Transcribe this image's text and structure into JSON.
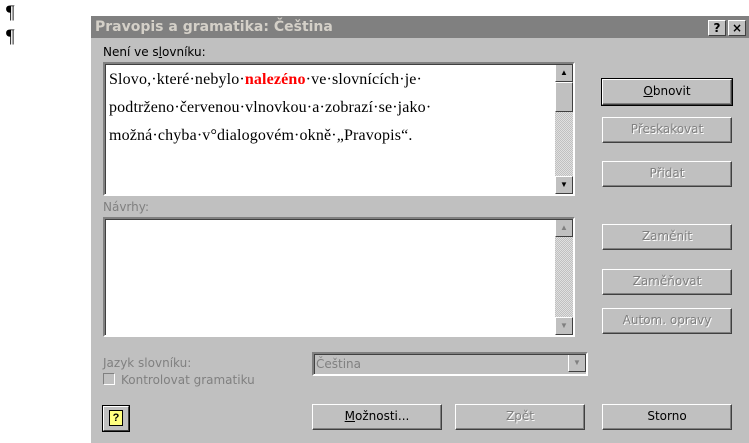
{
  "document": {
    "pilcrow": "¶"
  },
  "dialog": {
    "title": "Pravopis a gramatika: Čeština",
    "help_button": "?",
    "close_button": "×",
    "not_in_dictionary_label": "Není ve slovníku:",
    "text": {
      "before": "Slovo,·které·nebylo·",
      "highlight": "nalezéno",
      "after": "·ve·slovnících·je· podtrženo·červenou·vlnovkou·a·zobrazí·se·jako· možná·chyba·v°dialogovém·okně·„Pravopis“."
    },
    "suggestions_label": "Návrhy:",
    "dictionary_language_label": "Jazyk slovníku:",
    "dictionary_language_value": "Čeština",
    "check_grammar_label": "Kontrolovat gramatiku",
    "buttons": {
      "obnovit": "Obnovit",
      "preskakovat": "Přeskakovat",
      "pridat": "Přidat",
      "zamenit": "Zaměnit",
      "zamenovat": "Zaměňovat",
      "autom_opravy": "Autom. opravy",
      "moznosti": "Možnosti...",
      "zpet": "Zpět",
      "storno": "Storno"
    },
    "icons": {
      "help": "help-icon",
      "scroll_up": "arrow-up-icon",
      "scroll_down": "arrow-down-icon",
      "dropdown": "chevron-down-icon"
    }
  }
}
